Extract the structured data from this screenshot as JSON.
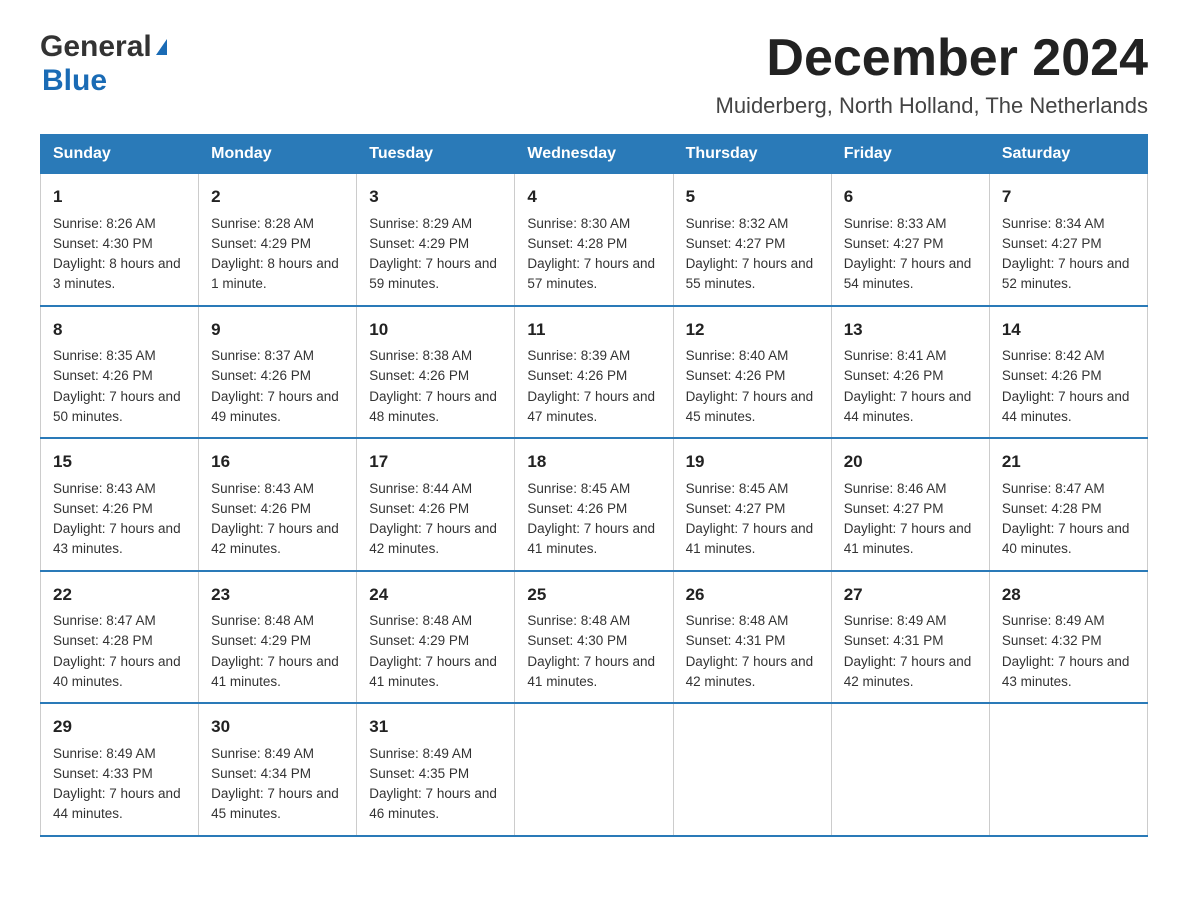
{
  "logo": {
    "general": "General",
    "blue": "Blue",
    "alt": "GeneralBlue logo"
  },
  "title": {
    "month_year": "December 2024",
    "location": "Muiderberg, North Holland, The Netherlands"
  },
  "days_of_week": [
    "Sunday",
    "Monday",
    "Tuesday",
    "Wednesday",
    "Thursday",
    "Friday",
    "Saturday"
  ],
  "weeks": [
    [
      {
        "day": "1",
        "sunrise": "Sunrise: 8:26 AM",
        "sunset": "Sunset: 4:30 PM",
        "daylight": "Daylight: 8 hours and 3 minutes."
      },
      {
        "day": "2",
        "sunrise": "Sunrise: 8:28 AM",
        "sunset": "Sunset: 4:29 PM",
        "daylight": "Daylight: 8 hours and 1 minute."
      },
      {
        "day": "3",
        "sunrise": "Sunrise: 8:29 AM",
        "sunset": "Sunset: 4:29 PM",
        "daylight": "Daylight: 7 hours and 59 minutes."
      },
      {
        "day": "4",
        "sunrise": "Sunrise: 8:30 AM",
        "sunset": "Sunset: 4:28 PM",
        "daylight": "Daylight: 7 hours and 57 minutes."
      },
      {
        "day": "5",
        "sunrise": "Sunrise: 8:32 AM",
        "sunset": "Sunset: 4:27 PM",
        "daylight": "Daylight: 7 hours and 55 minutes."
      },
      {
        "day": "6",
        "sunrise": "Sunrise: 8:33 AM",
        "sunset": "Sunset: 4:27 PM",
        "daylight": "Daylight: 7 hours and 54 minutes."
      },
      {
        "day": "7",
        "sunrise": "Sunrise: 8:34 AM",
        "sunset": "Sunset: 4:27 PM",
        "daylight": "Daylight: 7 hours and 52 minutes."
      }
    ],
    [
      {
        "day": "8",
        "sunrise": "Sunrise: 8:35 AM",
        "sunset": "Sunset: 4:26 PM",
        "daylight": "Daylight: 7 hours and 50 minutes."
      },
      {
        "day": "9",
        "sunrise": "Sunrise: 8:37 AM",
        "sunset": "Sunset: 4:26 PM",
        "daylight": "Daylight: 7 hours and 49 minutes."
      },
      {
        "day": "10",
        "sunrise": "Sunrise: 8:38 AM",
        "sunset": "Sunset: 4:26 PM",
        "daylight": "Daylight: 7 hours and 48 minutes."
      },
      {
        "day": "11",
        "sunrise": "Sunrise: 8:39 AM",
        "sunset": "Sunset: 4:26 PM",
        "daylight": "Daylight: 7 hours and 47 minutes."
      },
      {
        "day": "12",
        "sunrise": "Sunrise: 8:40 AM",
        "sunset": "Sunset: 4:26 PM",
        "daylight": "Daylight: 7 hours and 45 minutes."
      },
      {
        "day": "13",
        "sunrise": "Sunrise: 8:41 AM",
        "sunset": "Sunset: 4:26 PM",
        "daylight": "Daylight: 7 hours and 44 minutes."
      },
      {
        "day": "14",
        "sunrise": "Sunrise: 8:42 AM",
        "sunset": "Sunset: 4:26 PM",
        "daylight": "Daylight: 7 hours and 44 minutes."
      }
    ],
    [
      {
        "day": "15",
        "sunrise": "Sunrise: 8:43 AM",
        "sunset": "Sunset: 4:26 PM",
        "daylight": "Daylight: 7 hours and 43 minutes."
      },
      {
        "day": "16",
        "sunrise": "Sunrise: 8:43 AM",
        "sunset": "Sunset: 4:26 PM",
        "daylight": "Daylight: 7 hours and 42 minutes."
      },
      {
        "day": "17",
        "sunrise": "Sunrise: 8:44 AM",
        "sunset": "Sunset: 4:26 PM",
        "daylight": "Daylight: 7 hours and 42 minutes."
      },
      {
        "day": "18",
        "sunrise": "Sunrise: 8:45 AM",
        "sunset": "Sunset: 4:26 PM",
        "daylight": "Daylight: 7 hours and 41 minutes."
      },
      {
        "day": "19",
        "sunrise": "Sunrise: 8:45 AM",
        "sunset": "Sunset: 4:27 PM",
        "daylight": "Daylight: 7 hours and 41 minutes."
      },
      {
        "day": "20",
        "sunrise": "Sunrise: 8:46 AM",
        "sunset": "Sunset: 4:27 PM",
        "daylight": "Daylight: 7 hours and 41 minutes."
      },
      {
        "day": "21",
        "sunrise": "Sunrise: 8:47 AM",
        "sunset": "Sunset: 4:28 PM",
        "daylight": "Daylight: 7 hours and 40 minutes."
      }
    ],
    [
      {
        "day": "22",
        "sunrise": "Sunrise: 8:47 AM",
        "sunset": "Sunset: 4:28 PM",
        "daylight": "Daylight: 7 hours and 40 minutes."
      },
      {
        "day": "23",
        "sunrise": "Sunrise: 8:48 AM",
        "sunset": "Sunset: 4:29 PM",
        "daylight": "Daylight: 7 hours and 41 minutes."
      },
      {
        "day": "24",
        "sunrise": "Sunrise: 8:48 AM",
        "sunset": "Sunset: 4:29 PM",
        "daylight": "Daylight: 7 hours and 41 minutes."
      },
      {
        "day": "25",
        "sunrise": "Sunrise: 8:48 AM",
        "sunset": "Sunset: 4:30 PM",
        "daylight": "Daylight: 7 hours and 41 minutes."
      },
      {
        "day": "26",
        "sunrise": "Sunrise: 8:48 AM",
        "sunset": "Sunset: 4:31 PM",
        "daylight": "Daylight: 7 hours and 42 minutes."
      },
      {
        "day": "27",
        "sunrise": "Sunrise: 8:49 AM",
        "sunset": "Sunset: 4:31 PM",
        "daylight": "Daylight: 7 hours and 42 minutes."
      },
      {
        "day": "28",
        "sunrise": "Sunrise: 8:49 AM",
        "sunset": "Sunset: 4:32 PM",
        "daylight": "Daylight: 7 hours and 43 minutes."
      }
    ],
    [
      {
        "day": "29",
        "sunrise": "Sunrise: 8:49 AM",
        "sunset": "Sunset: 4:33 PM",
        "daylight": "Daylight: 7 hours and 44 minutes."
      },
      {
        "day": "30",
        "sunrise": "Sunrise: 8:49 AM",
        "sunset": "Sunset: 4:34 PM",
        "daylight": "Daylight: 7 hours and 45 minutes."
      },
      {
        "day": "31",
        "sunrise": "Sunrise: 8:49 AM",
        "sunset": "Sunset: 4:35 PM",
        "daylight": "Daylight: 7 hours and 46 minutes."
      },
      null,
      null,
      null,
      null
    ]
  ]
}
